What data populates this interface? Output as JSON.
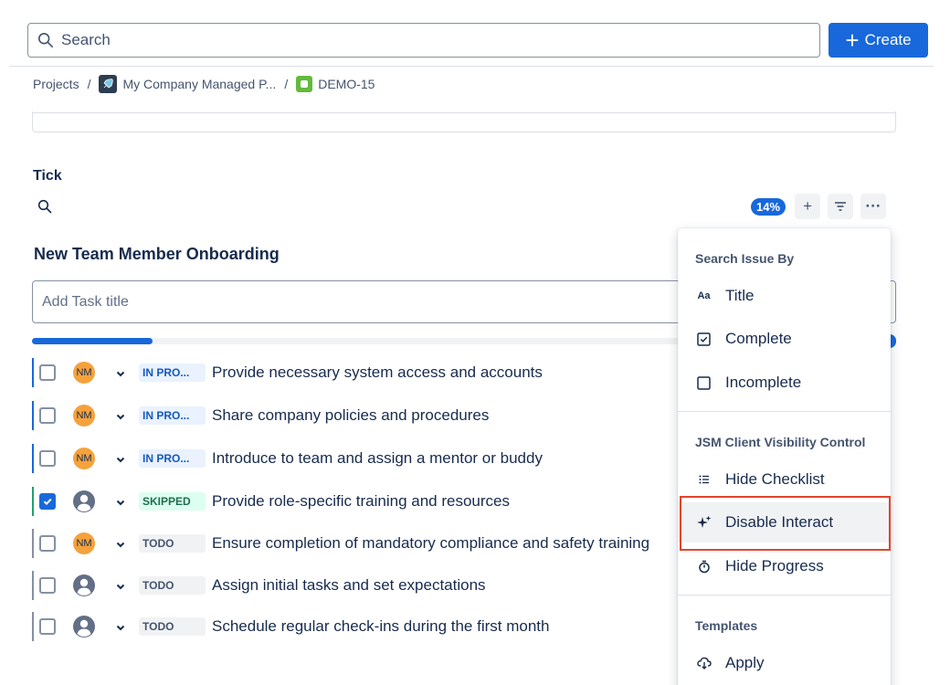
{
  "search": {
    "placeholder": "Search"
  },
  "create_button": {
    "label": "Create"
  },
  "breadcrumb": {
    "items": [
      "Projects",
      "My Company Managed P...",
      "DEMO-15"
    ],
    "separator": "/"
  },
  "section": {
    "title": "Tick"
  },
  "toolbar": {
    "progress_badge": "14%",
    "add_label": "+",
    "more_label": "···"
  },
  "checklist": {
    "title": "New Team Member Onboarding",
    "add_placeholder": "Add Task title",
    "progress": 0.14
  },
  "tasks": [
    {
      "checked": false,
      "assignee": "NM",
      "status": "IN PRO...",
      "status_type": "inpro",
      "text": "Provide necessary system access and accounts",
      "bar_color": "#1868db"
    },
    {
      "checked": false,
      "assignee": "NM",
      "status": "IN PRO...",
      "status_type": "inpro",
      "text": "Share company policies and procedures",
      "bar_color": "#1868db"
    },
    {
      "checked": false,
      "assignee": "NM",
      "status": "IN PRO...",
      "status_type": "inpro",
      "text": "Introduce to team and assign a mentor or buddy",
      "bar_color": "#1868db"
    },
    {
      "checked": true,
      "assignee": "",
      "status": "SKIPPED",
      "status_type": "skipped",
      "text": "Provide role-specific training and resources",
      "bar_color": "#22a06b"
    },
    {
      "checked": false,
      "assignee": "NM",
      "status": "TODO",
      "status_type": "todo",
      "text": "Ensure completion of mandatory compliance and safety training",
      "bar_color": "#8590a2"
    },
    {
      "checked": false,
      "assignee": "",
      "status": "TODO",
      "status_type": "todo",
      "text": "Assign initial tasks and set expectations",
      "bar_color": "#8590a2"
    },
    {
      "checked": false,
      "assignee": "",
      "status": "TODO",
      "status_type": "todo",
      "text": "Schedule regular check-ins during the first month",
      "bar_color": "#8590a2"
    }
  ],
  "menu": {
    "search_heading": "Search Issue By",
    "search_items": [
      {
        "label": "Title",
        "icon": "Aa"
      },
      {
        "label": "Complete",
        "icon": "checkbox-checked-icon"
      },
      {
        "label": "Incomplete",
        "icon": "checkbox-empty-icon"
      }
    ],
    "visibility_heading": "JSM Client Visibility Control",
    "visibility_items": [
      {
        "label": "Hide Checklist",
        "icon": "list-icon"
      },
      {
        "label": "Disable Interact",
        "icon": "sparkle-icon"
      },
      {
        "label": "Hide Progress",
        "icon": "stopwatch-icon"
      }
    ],
    "templates_heading": "Templates",
    "template_items": [
      {
        "label": "Apply",
        "icon": "cloud-download-icon"
      }
    ]
  },
  "colors": {
    "accent": "#1868db",
    "highlight": "#e0452c",
    "avatar": "#f5a23d"
  }
}
